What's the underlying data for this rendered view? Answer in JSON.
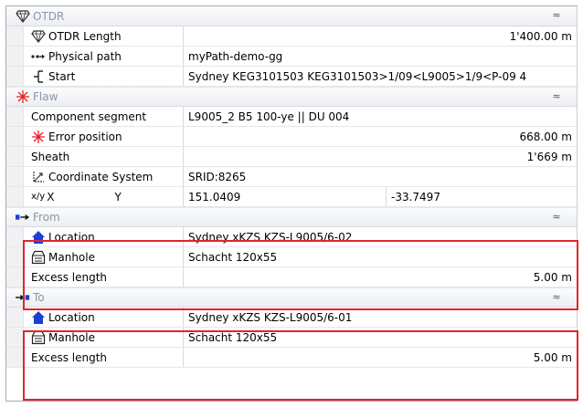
{
  "categories": {
    "otdr": {
      "title": "OTDR",
      "rows": [
        {
          "label": "OTDR Length",
          "value": "1'400.00 m"
        },
        {
          "label": "Physical path",
          "value": "myPath-demo-gg"
        },
        {
          "label": "Start",
          "value": "Sydney KEG3101503 KEG3101503>1/09<L9005>1/9<P-09 4"
        }
      ]
    },
    "flaw": {
      "title": "Flaw",
      "rows": [
        {
          "label": "Component segment",
          "value": "L9005_2 B5 100-ye || DU 004"
        },
        {
          "label": "Error position",
          "value": "668.00 m"
        },
        {
          "label": "Sheath",
          "value": "1'669 m"
        },
        {
          "label": "Coordinate System",
          "value": "SRID:8265"
        }
      ],
      "xy": {
        "prefix": "x/y",
        "x_label": "X",
        "y_label": "Y",
        "x_value": "151.0409",
        "y_value": "-33.7497"
      }
    },
    "from": {
      "title": "From",
      "rows": [
        {
          "label": "Location",
          "value": "Sydney xKZS KZS-L9005/6-02"
        },
        {
          "label": "Manhole",
          "value": "Schacht 120x55"
        },
        {
          "label": "Excess length",
          "value": "5.00 m"
        }
      ]
    },
    "to": {
      "title": "To",
      "rows": [
        {
          "label": "Location",
          "value": "Sydney xKZS KZS-L9005/6-01"
        },
        {
          "label": "Manhole",
          "value": "Schacht 120x55"
        },
        {
          "label": "Excess length",
          "value": "5.00 m"
        }
      ]
    }
  },
  "collapse_glyph": "≈",
  "colors": {
    "highlight_box": "#e0252b",
    "category_text": "#8a95a3",
    "flaw_icon": "#e8202a",
    "location_icon": "#1b3fd6"
  }
}
